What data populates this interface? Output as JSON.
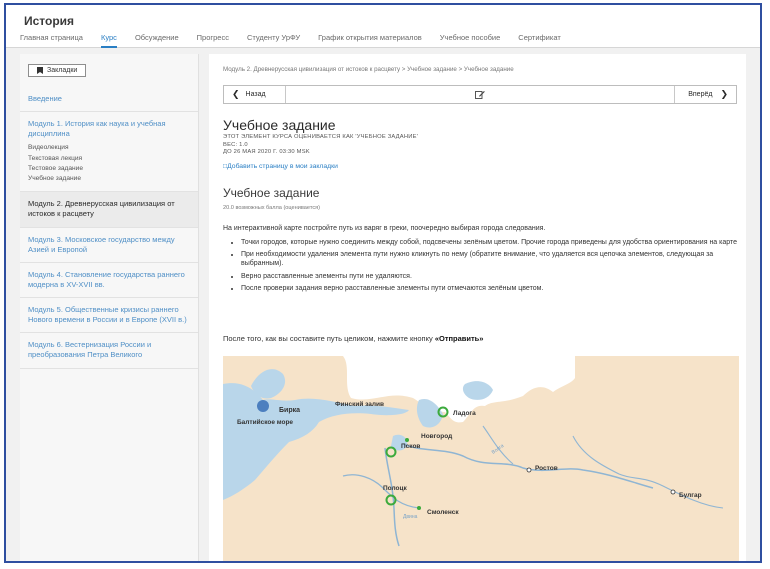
{
  "app": {
    "title": "История"
  },
  "nav": {
    "tabs": [
      {
        "label": "Главная страница",
        "active": false
      },
      {
        "label": "Курс",
        "active": true
      },
      {
        "label": "Обсуждение",
        "active": false
      },
      {
        "label": "Прогресс",
        "active": false
      },
      {
        "label": "Студенту УрФУ",
        "active": false
      },
      {
        "label": "График открытия материалов",
        "active": false
      },
      {
        "label": "Учебное пособие",
        "active": false
      },
      {
        "label": "Сертификат",
        "active": false
      }
    ]
  },
  "sidebar": {
    "bookmarks_label": "Закладки",
    "sections": [
      {
        "label": "Введение",
        "subsections": []
      },
      {
        "label": "Модуль 1. История как наука и учебная дисциплина",
        "subsections": [
          "Видеолекция",
          "Текстовая лекция",
          "Тестовое задание",
          "Учебное задание"
        ]
      },
      {
        "label": "Модуль 2. Древнерусская цивилизация от истоков к расцвету",
        "current": true,
        "subsections": []
      },
      {
        "label": "Модуль 3. Московское государство между Азией и Европой",
        "subsections": []
      },
      {
        "label": "Модуль 4. Становление государства раннего модерна в XV-XVII вв.",
        "subsections": []
      },
      {
        "label": "Модуль 5. Общественные кризисы раннего Нового времени в России и в Европе (XVII в.)",
        "subsections": []
      },
      {
        "label": "Модуль 6. Вестернизация России и преобразования Петра Великого",
        "subsections": []
      }
    ]
  },
  "content": {
    "breadcrumb": "Модуль 2. Древнерусская цивилизация от истоков к расцвету > Учебное задание > Учебное задание",
    "prev_label": "Назад",
    "next_label": "Вперёд",
    "title": "Учебное задание",
    "meta_line1": "ЭТОТ ЭЛЕМЕНТ КУРСА ОЦЕНИВАЕТСЯ КАК 'УЧЕБНОЕ ЗАДАНИЕ'",
    "meta_line2": "ВЕС: 1.0",
    "meta_line3": "ДО 26 МАЯ 2020 Г. 03:30 MSK",
    "add_bookmark": "Добавить страницу в мои закладки",
    "subtitle": "Учебное задание",
    "points": "20.0 возможных балла (оценивается)",
    "intro": "На интерактивной карте постройте путь из варяг в греки, поочередно выбирая города следования.",
    "bullets": [
      "Точки городов, которые нужно соединить между собой, подсвечены зелёным цветом. Прочие города приведены для удобства ориентирования на карте",
      "При необходимости удаления элемента пути нужно кликнуть по нему (обратите внимание, что удаляется вся цепочка элементов, следующая за выбранным).",
      "Верно расставленные элементы пути не удаляются.",
      "После проверки задания верно расставленные элементы пути отмечаются зелёным цветом."
    ],
    "after_prefix": "После того, как вы составите путь целиком, нажмите кнопку ",
    "after_button": "«Отправить»"
  },
  "map": {
    "labels": {
      "birka": "Бирка",
      "baltic": "Балтийское море",
      "finnish_gulf": "Финский залив",
      "ladoga": "Ладога",
      "novgorod": "Новгород",
      "pskov": "Псков",
      "rostov": "Ростов",
      "bulgar": "Булгар",
      "polotsk": "Полоцк",
      "smolensk": "Смоленск",
      "volga": "Волга",
      "dvina": "Двина"
    },
    "colors": {
      "land": "#f6e3c9",
      "water": "#b9d6ea",
      "river": "#8fb5d3",
      "highlight": "#3caa3c"
    }
  }
}
